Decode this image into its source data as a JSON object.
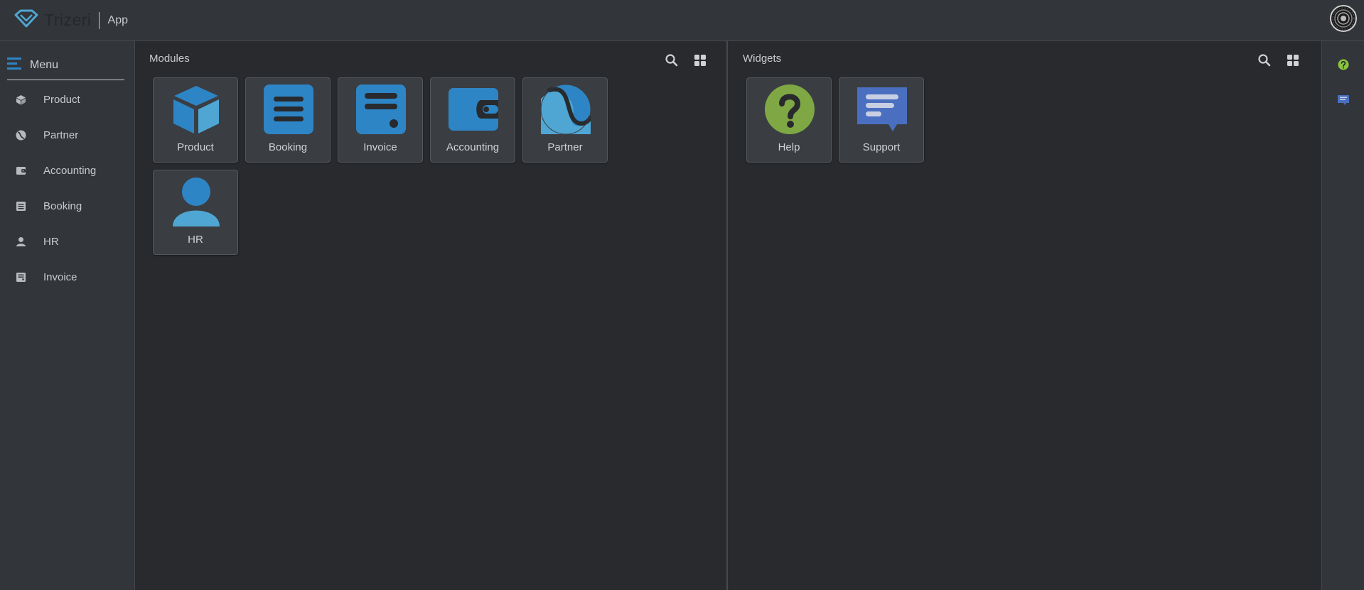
{
  "header": {
    "brand": "Trizeri",
    "app_label": "App",
    "logo_icon": "diamond-logo-icon",
    "avatar_icon": "user-avatar"
  },
  "sidebar": {
    "menu_label": "Menu",
    "menu_icon": "menu-lines-icon",
    "items": [
      {
        "label": "Product",
        "icon": "cube-icon"
      },
      {
        "label": "Partner",
        "icon": "partner-icon"
      },
      {
        "label": "Accounting",
        "icon": "wallet-icon"
      },
      {
        "label": "Booking",
        "icon": "list-icon"
      },
      {
        "label": "HR",
        "icon": "person-icon"
      },
      {
        "label": "Invoice",
        "icon": "invoice-icon"
      }
    ]
  },
  "modules": {
    "title": "Modules",
    "search_icon": "search-icon",
    "grid_icon": "grid-icon",
    "tiles": [
      {
        "label": "Product",
        "icon": "cube-icon"
      },
      {
        "label": "Booking",
        "icon": "list-icon"
      },
      {
        "label": "Invoice",
        "icon": "invoice-icon"
      },
      {
        "label": "Accounting",
        "icon": "wallet-icon"
      },
      {
        "label": "Partner",
        "icon": "partner-icon"
      },
      {
        "label": "HR",
        "icon": "person-icon"
      }
    ]
  },
  "widgets": {
    "title": "Widgets",
    "search_icon": "search-icon",
    "grid_icon": "grid-icon",
    "tiles": [
      {
        "label": "Help",
        "icon": "help-icon"
      },
      {
        "label": "Support",
        "icon": "support-chat-icon"
      }
    ]
  },
  "rightbar": {
    "items": [
      {
        "icon": "help-icon"
      },
      {
        "icon": "support-chat-icon"
      }
    ]
  },
  "colors": {
    "accent": "#2e85c5",
    "accent_light": "#4fa6d3",
    "help_green": "#7fa844",
    "support_blue": "#4a6fc0",
    "background": "#282a2e",
    "chrome": "#32353a"
  }
}
